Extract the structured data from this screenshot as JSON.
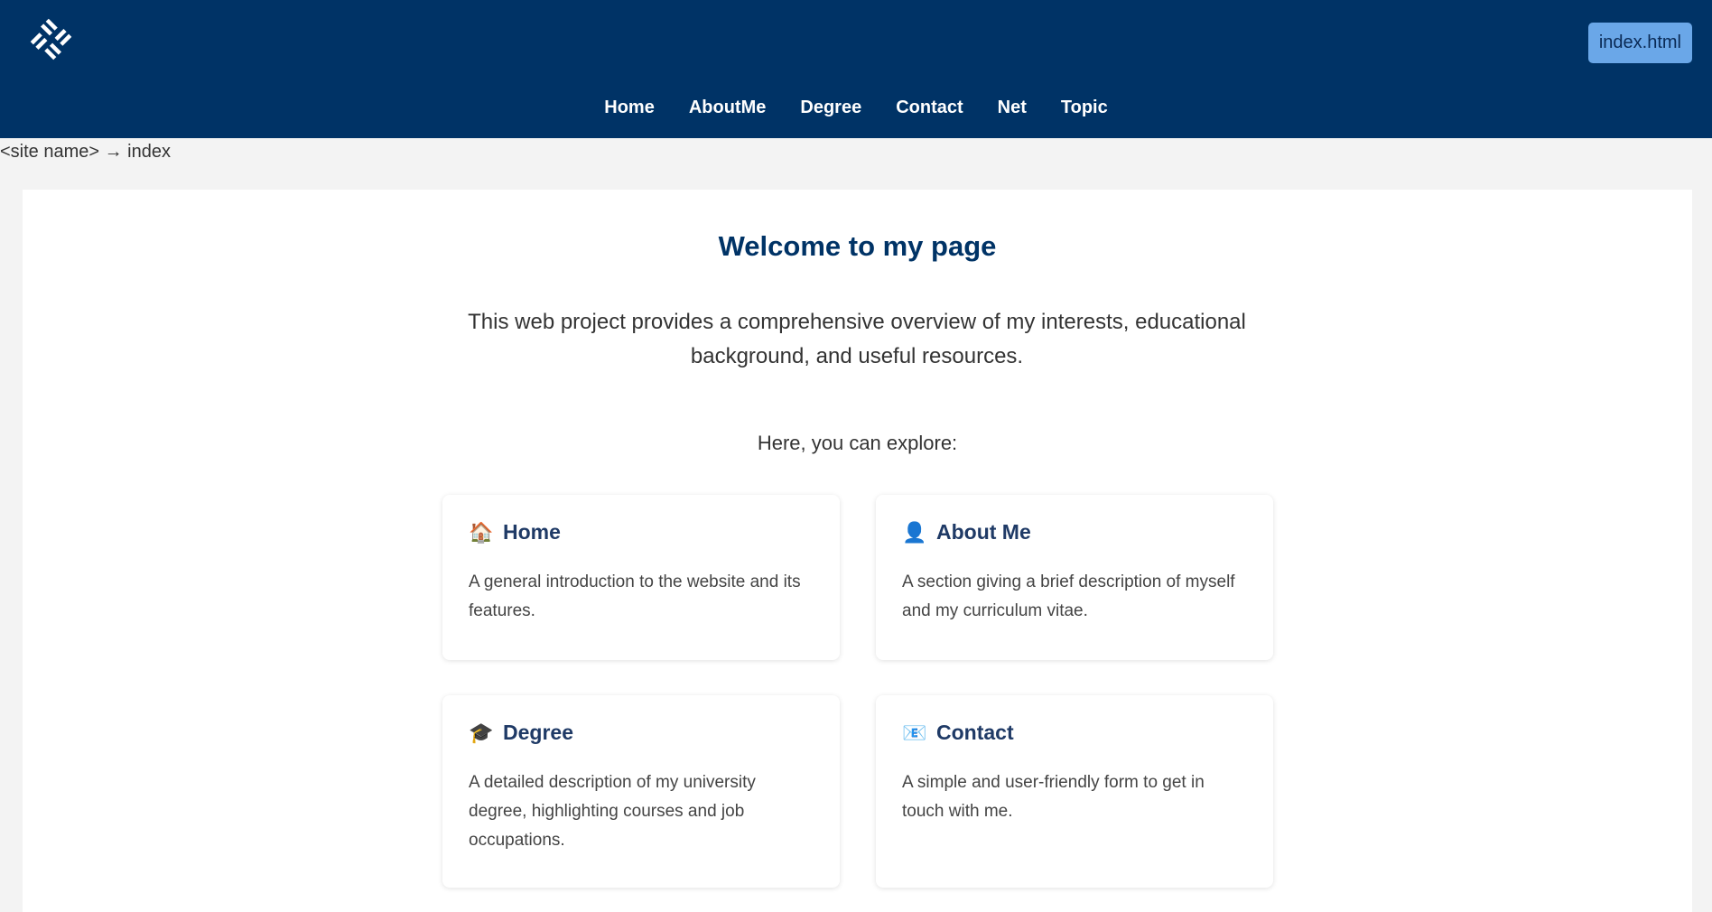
{
  "header": {
    "logo_name": "site-logo",
    "file_badge": "index.html",
    "nav": [
      {
        "label": "Home"
      },
      {
        "label": "AboutMe"
      },
      {
        "label": "Degree"
      },
      {
        "label": "Contact"
      },
      {
        "label": "Net"
      },
      {
        "label": "Topic"
      }
    ],
    "colors": {
      "header_bg": "#003366",
      "badge_bg": "#6aa7e8"
    }
  },
  "breadcrumb": "<site name> → index",
  "main": {
    "title": "Welcome to my page",
    "intro": "This web project provides a comprehensive overview of my interests, educational background, and useful resources.",
    "explore": "Here, you can explore:",
    "cards": [
      {
        "icon": "house-icon",
        "emoji": "🏠",
        "title": "Home",
        "desc": "A general introduction to the website and its features."
      },
      {
        "icon": "user-icon",
        "emoji": "👤",
        "title": "About Me",
        "desc": "A section giving a brief description of myself and my curriculum vitae."
      },
      {
        "icon": "graduation-cap-icon",
        "emoji": "🎓",
        "title": "Degree",
        "desc": "A detailed description of my university degree, highlighting courses and job occupations."
      },
      {
        "icon": "envelope-icon",
        "emoji": "📧",
        "title": "Contact",
        "desc": "A simple and user-friendly form to get in touch with me."
      }
    ]
  }
}
